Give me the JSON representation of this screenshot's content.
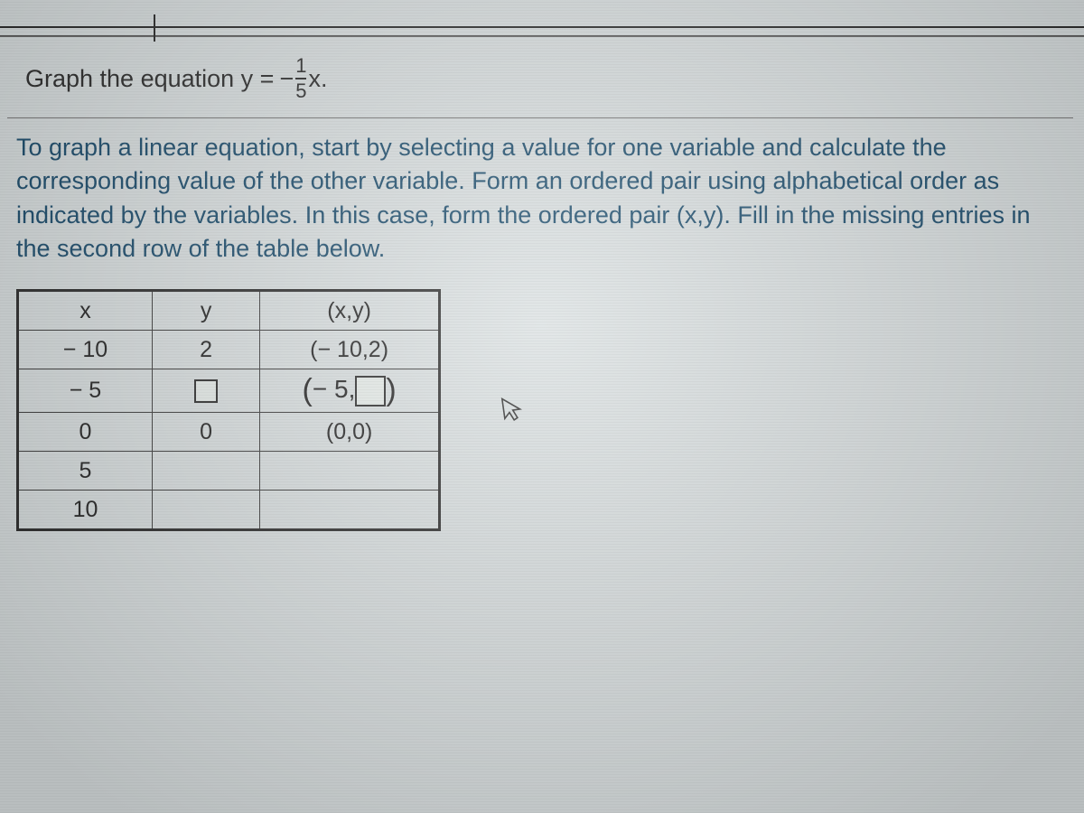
{
  "cropped_header_text": "",
  "question": {
    "lead": "Graph the equation y = ",
    "minus": "−",
    "fraction": {
      "num": "1",
      "den": "5"
    },
    "trail": "x."
  },
  "instruction": "To graph a linear equation, start by selecting a value for one variable and calculate the corresponding value of the other variable. Form an ordered pair using alphabetical order as indicated by the variables. In this case, form the ordered pair (x,y). Fill in the missing entries in the second row of the table below.",
  "table": {
    "headers": {
      "x": "x",
      "y": "y",
      "xy": "(x,y)"
    },
    "rows": [
      {
        "x": "− 10",
        "y": "2",
        "xy": "(− 10,2)"
      },
      {
        "x": "− 5",
        "y": "",
        "xy_open": "(",
        "xy_mid": "− 5,",
        "xy_close": ")"
      },
      {
        "x": "0",
        "y": "0",
        "xy": "(0,0)"
      },
      {
        "x": "5",
        "y": "",
        "xy": ""
      },
      {
        "x": "10",
        "y": "",
        "xy": ""
      }
    ]
  },
  "chart_data": {
    "type": "table",
    "title": "Ordered pairs for y = -(1/5)x",
    "columns": [
      "x",
      "y",
      "(x,y)"
    ],
    "rows": [
      {
        "x": -10,
        "y": 2,
        "pair": "(-10,2)"
      },
      {
        "x": -5,
        "y": null,
        "pair": "(-5, )"
      },
      {
        "x": 0,
        "y": 0,
        "pair": "(0,0)"
      },
      {
        "x": 5,
        "y": null,
        "pair": ""
      },
      {
        "x": 10,
        "y": null,
        "pair": ""
      }
    ],
    "equation": "y = -(1/5)x"
  }
}
